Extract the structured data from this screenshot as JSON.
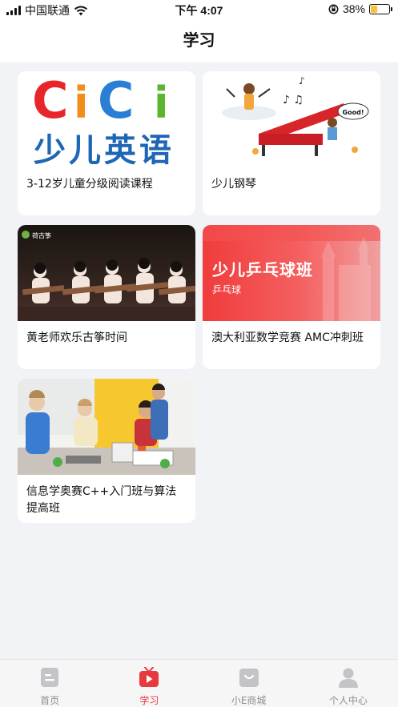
{
  "status_bar": {
    "carrier": "中国联通",
    "time": "下午 4:07",
    "battery_percent_text": "38%",
    "battery_level": 0.38
  },
  "header": {
    "title": "学习"
  },
  "courses": [
    {
      "title": "3-12岁儿童分级阅读课程",
      "thumb": "cici-english-logo"
    },
    {
      "title": "少儿钢琴",
      "thumb": "piano-illustration"
    },
    {
      "title": "黄老师欢乐古筝时间",
      "thumb": "guzheng-performance-photo"
    },
    {
      "title": "澳大利亚数学竞赛 AMC冲刺班",
      "thumb": "pingpong-banner",
      "banner_title": "少儿乒乓球班",
      "banner_sub": "乒乓球"
    },
    {
      "title": "信息学奥赛C++入门班与算法提高班",
      "thumb": "kids-building-photo"
    }
  ],
  "thumb_text": {
    "english_logo": "CiCi",
    "english_sub": "少儿英语",
    "piano_bubble": "Good!",
    "guzheng_tag": "荷古筝"
  },
  "tabs": [
    {
      "label": "首页",
      "icon": "home-icon",
      "active": false
    },
    {
      "label": "学习",
      "icon": "play-icon",
      "active": true
    },
    {
      "label": "小E商城",
      "icon": "shop-icon",
      "active": false
    },
    {
      "label": "个人中心",
      "icon": "person-icon",
      "active": false
    }
  ],
  "colors": {
    "accent": "#e8393f",
    "tab_inactive": "#c4c4c8",
    "background": "#f2f3f6",
    "battery": "#f7c23a"
  }
}
